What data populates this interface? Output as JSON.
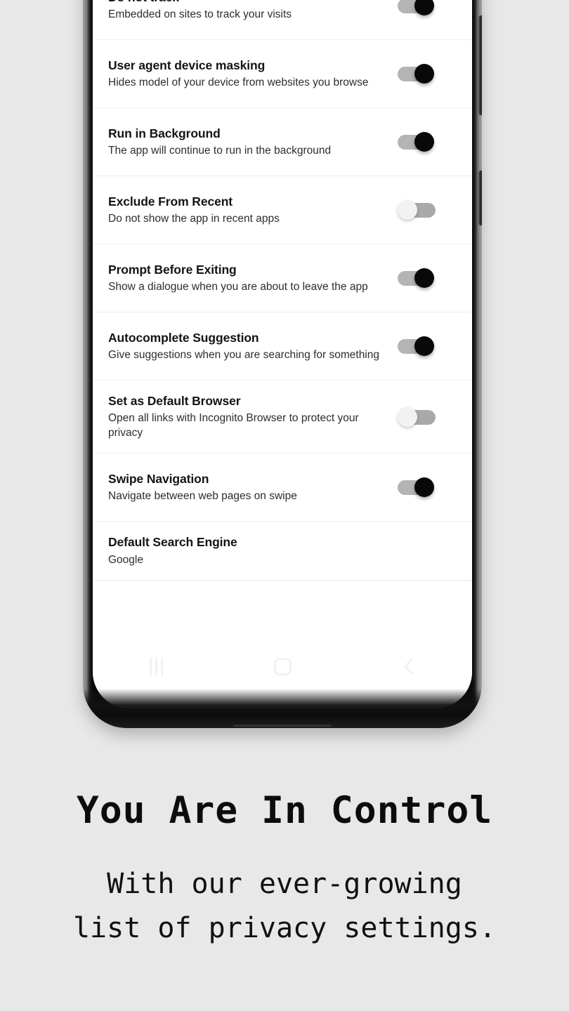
{
  "background_color": "#e8e8e8",
  "device": {
    "name": "android-phone-mockup",
    "frame_color": "#0a0a0a",
    "screen_color": "#ffffff",
    "side_buttons": [
      "volume-button",
      "power-button"
    ]
  },
  "screen": {
    "settings": {
      "rows": [
        {
          "title": "Do not track",
          "subtitle": "Embedded on sites to track your visits",
          "control": "toggle",
          "state": "on"
        },
        {
          "title": "User agent device masking",
          "subtitle": "Hides model of your device from websites you browse",
          "control": "toggle",
          "state": "on"
        },
        {
          "title": "Run in Background",
          "subtitle": "The app will continue to run in the background",
          "control": "toggle",
          "state": "on"
        },
        {
          "title": "Exclude From Recent",
          "subtitle": "Do not show the app in recent apps",
          "control": "toggle",
          "state": "off"
        },
        {
          "title": "Prompt Before Exiting",
          "subtitle": "Show a dialogue when you are about to leave the app",
          "control": "toggle",
          "state": "on"
        },
        {
          "title": "Autocomplete Suggestion",
          "subtitle": "Give suggestions when you are searching for something",
          "control": "toggle",
          "state": "on"
        },
        {
          "title": "Set as Default Browser",
          "subtitle": "Open all links with Incognito Browser to protect your privacy",
          "control": "toggle",
          "state": "off"
        },
        {
          "title": "Swipe Navigation",
          "subtitle": "Navigate between web pages on swipe",
          "control": "toggle",
          "state": "on"
        },
        {
          "title": "Default Search Engine",
          "subtitle": "Google",
          "control": "none",
          "state": ""
        }
      ]
    },
    "nav_bar": {
      "recents_icon": "recents-icon",
      "home_icon": "home-icon",
      "back_icon": "back-icon",
      "icon_color": "#f1f1f1"
    }
  },
  "marketing": {
    "headline": "You Are In Control",
    "subhead": "With our ever-growing\nlist of privacy settings."
  },
  "colors": {
    "toggle_on_thumb": "#090909",
    "toggle_on_track": "#b4b4b4",
    "toggle_off_thumb": "#f2f2f2",
    "toggle_off_track": "#a9a9a9",
    "title_text": "#141414",
    "subtitle_text": "#2d2d2d",
    "divider": "#eeeeee"
  }
}
